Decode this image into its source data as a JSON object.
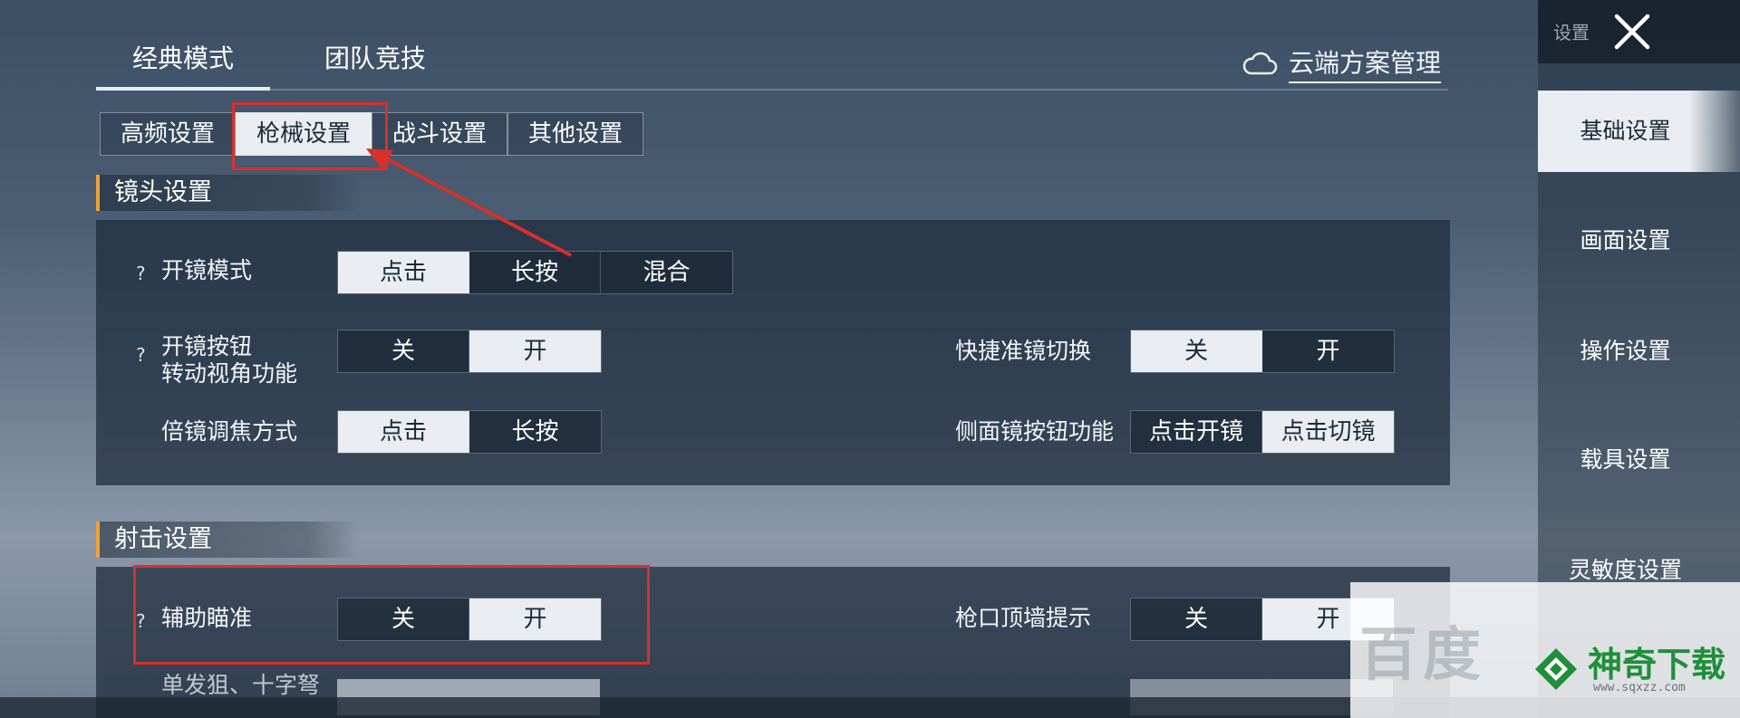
{
  "mode_tabs": [
    {
      "label": "经典模式",
      "active": true
    },
    {
      "label": "团队竞技",
      "active": false
    }
  ],
  "cloud": {
    "icon": "cloud-icon",
    "label": "云端方案管理"
  },
  "sub_tabs": [
    {
      "label": "高频设置",
      "active": false
    },
    {
      "label": "枪械设置",
      "active": true
    },
    {
      "label": "战斗设置",
      "active": false
    },
    {
      "label": "其他设置",
      "active": false
    }
  ],
  "lens_section": {
    "title": "镜头设置",
    "scope_mode": {
      "help": "?",
      "label": "开镜模式",
      "options": [
        "点击",
        "长按",
        "混合"
      ],
      "selected": "点击"
    },
    "scope_button_view": {
      "help": "?",
      "label_line1": "开镜按钮",
      "label_line2": "转动视角功能",
      "options": [
        "关",
        "开"
      ],
      "selected": "开"
    },
    "quick_scope_switch": {
      "label": "快捷准镜切换",
      "options": [
        "关",
        "开"
      ],
      "selected": "关"
    },
    "zoom_focus": {
      "label": "倍镜调焦方式",
      "options": [
        "点击",
        "长按"
      ],
      "selected": "点击"
    },
    "side_scope_button": {
      "label": "侧面镜按钮功能",
      "options": [
        "点击开镜",
        "点击切镜"
      ],
      "selected": "点击切镜"
    }
  },
  "shoot_section": {
    "title": "射击设置",
    "aim_assist": {
      "help": "?",
      "label": "辅助瞄准",
      "options": [
        "关",
        "开"
      ],
      "selected": "开"
    },
    "muzzle_wall": {
      "label": "枪口顶墙提示",
      "options": [
        "关",
        "开"
      ],
      "selected": "开"
    },
    "partial_label": "单发狙、十字弩"
  },
  "sidebar": {
    "tag": "设置",
    "close_icon": "close-icon",
    "items": [
      {
        "label": "基础设置",
        "active": true
      },
      {
        "label": "画面设置",
        "active": false
      },
      {
        "label": "操作设置",
        "active": false
      },
      {
        "label": "载具设置",
        "active": false
      },
      {
        "label": "灵敏度设置",
        "active": false
      }
    ]
  },
  "watermark": {
    "text": "百度",
    "brand": "神奇下载",
    "url": "www.sqxzz.com",
    "logo_icon": "diamond-logo-icon"
  },
  "colors": {
    "accent_orange": "#f0a13a",
    "annotation_red": "#d9302b",
    "selected_bg": "#e9edf1",
    "brand_green": "#1f8f3a"
  }
}
